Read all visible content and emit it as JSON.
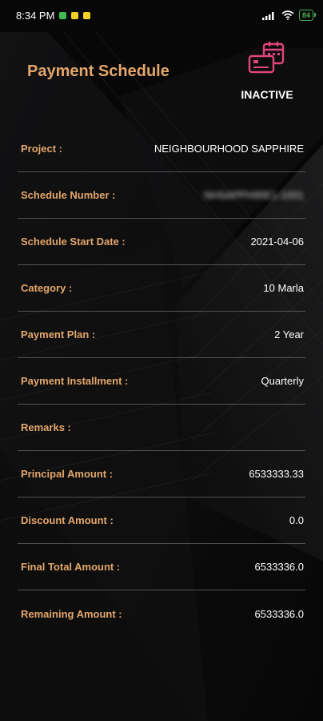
{
  "status_bar": {
    "time": "8:34 PM",
    "battery": "84",
    "notification_colors": [
      "#3fb950",
      "#f2d024",
      "#f2d024"
    ]
  },
  "header": {
    "title": "Payment Schedule",
    "status": "INACTIVE",
    "icon": "payment-calendar-icon",
    "icon_color": "#e0457b"
  },
  "details": [
    {
      "label": "Project :",
      "value": "NEIGHBOURHOOD SAPPHIRE",
      "blurred": false
    },
    {
      "label": "Schedule Number :",
      "value": "NHSAPPHIRE1-1001",
      "blurred": true
    },
    {
      "label": "Schedule Start Date :",
      "value": "2021-04-06",
      "blurred": false
    },
    {
      "label": "Category :",
      "value": "10 Marla",
      "blurred": false
    },
    {
      "label": "Payment Plan :",
      "value": "2 Year",
      "blurred": false
    },
    {
      "label": "Payment Installment :",
      "value": "Quarterly",
      "blurred": false
    },
    {
      "label": "Remarks :",
      "value": "",
      "blurred": false
    },
    {
      "label": "Principal Amount :",
      "value": "6533333.33",
      "blurred": false
    },
    {
      "label": "Discount Amount :",
      "value": "0.0",
      "blurred": false
    },
    {
      "label": "Final Total Amount :",
      "value": "6533336.0",
      "blurred": false
    },
    {
      "label": "Remaining Amount :",
      "value": "6533336.0",
      "blurred": false
    }
  ],
  "colors": {
    "label": "#e3a66b",
    "value": "#ffffff",
    "background": "#0b0b0c"
  }
}
